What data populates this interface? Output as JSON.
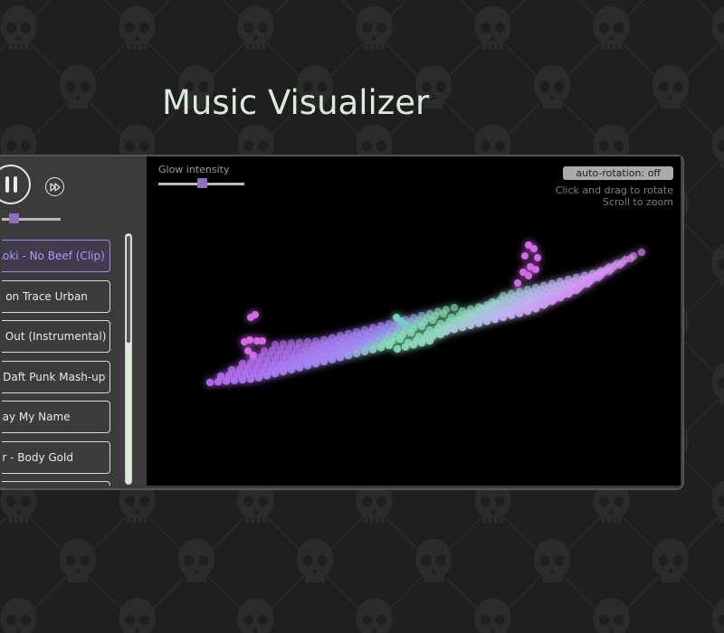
{
  "page": {
    "title": "Music Visualizer"
  },
  "player": {
    "progress": 0.2,
    "playlist": [
      {
        "label": "Aoki - No Beef (Clip)",
        "active": true
      },
      {
        "label": "e on Trace Urban",
        "active": false
      },
      {
        "label": "k Out (Instrumental)",
        "active": false
      },
      {
        "label": "- Daft Punk Mash-up",
        "active": false
      },
      {
        "label": "Say My Name",
        "active": false
      },
      {
        "label": "er - Body Gold",
        "active": false
      }
    ]
  },
  "visualizer": {
    "glow_label": "Glow intensity",
    "glow_value": 0.5,
    "autorotation_label": "auto-rotation: off",
    "hint_drag": "Click and drag to rotate",
    "hint_zoom": "Scroll to zoom"
  },
  "colors": {
    "background": "#1f1f1f",
    "title": "#d9eed9",
    "accent": "#8f6fc4",
    "active_track": "#b893ff",
    "viz_low": "#b07cf0",
    "viz_mid": "#7fe0a8"
  },
  "icons": [
    "pause-icon",
    "fast-forward-icon",
    "skull-pattern"
  ]
}
